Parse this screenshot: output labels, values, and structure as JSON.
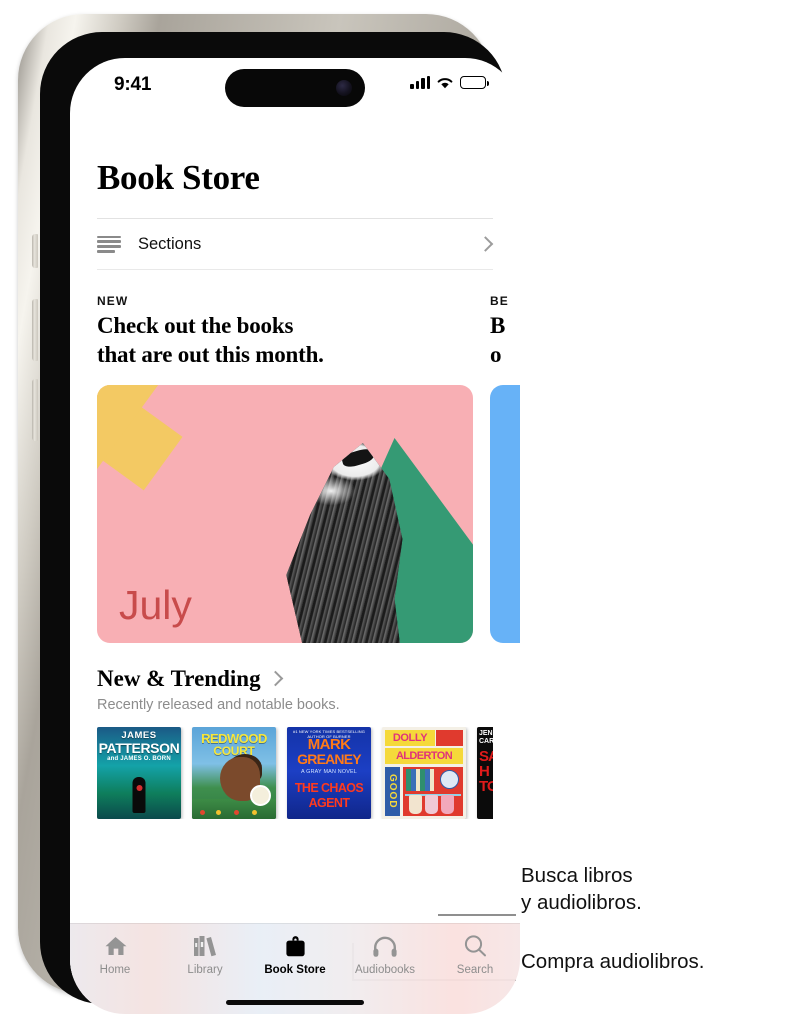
{
  "status_bar": {
    "time": "9:41",
    "icons": [
      "cellular-signal-icon",
      "wifi-icon",
      "battery-icon"
    ]
  },
  "app": {
    "title": "Book Store",
    "sections_row": {
      "label": "Sections",
      "menu_icon": "hamburger-icon",
      "chevron": "chevron-right-icon"
    },
    "feature_cards": [
      {
        "kicker": "NEW",
        "headline": "Check out the books\nthat are out this month.",
        "art_label": "July",
        "art_bg": "#f8afb4",
        "art_accent": "#f3c963",
        "art_green": "#359a74",
        "label_color": "#c84b4b"
      },
      {
        "kicker": "BE",
        "headline_line1": "B",
        "headline_line2": "o",
        "art_bg": "#67b2f7"
      }
    ],
    "trending": {
      "title": "New & Trending",
      "chevron": "chevron-right-icon",
      "subtitle": "Recently released and notable books."
    },
    "books": [
      {
        "author_small": "JAMES",
        "author_big": "PATTERSON",
        "author_sub": "and JAMES O. BORN"
      },
      {
        "title_line1": "REDWOOD",
        "title_line2": "COURT"
      },
      {
        "top_blurb": "#1 NEW YORK TIMES BESTSELLING AUTHOR OF BURNER",
        "author_line1": "MARK",
        "author_line2": "GREANEY",
        "series": "A  GRAY MAN  NOVEL",
        "title_line1": "THE CHAOS",
        "title_line2": "AGENT"
      },
      {
        "author_line1": "DOLLY",
        "author_line2": "ALDERTON",
        "title": "GOOD"
      },
      {
        "header": "JEN\nCAR",
        "title": "SA\nH\nTO"
      }
    ],
    "tabs": [
      {
        "label": "Home",
        "icon": "home-icon",
        "active": false
      },
      {
        "label": "Library",
        "icon": "books-icon",
        "active": false
      },
      {
        "label": "Book Store",
        "icon": "bag-icon",
        "active": true
      },
      {
        "label": "Audiobooks",
        "icon": "headphones-icon",
        "active": false
      },
      {
        "label": "Search",
        "icon": "search-icon",
        "active": false
      }
    ]
  },
  "callouts": [
    {
      "text": "Busca libros\ny audiolibros.",
      "points_to": "Search"
    },
    {
      "text": "Compra audiolibros.",
      "points_to": "Audiobooks"
    }
  ],
  "colors": {
    "accent_pink": "#f8afb4",
    "accent_yellow": "#f3c963",
    "accent_green": "#359a74",
    "accent_blue": "#67b2f7",
    "july_red": "#c84b4b",
    "muted_text": "#8c8c8c"
  }
}
